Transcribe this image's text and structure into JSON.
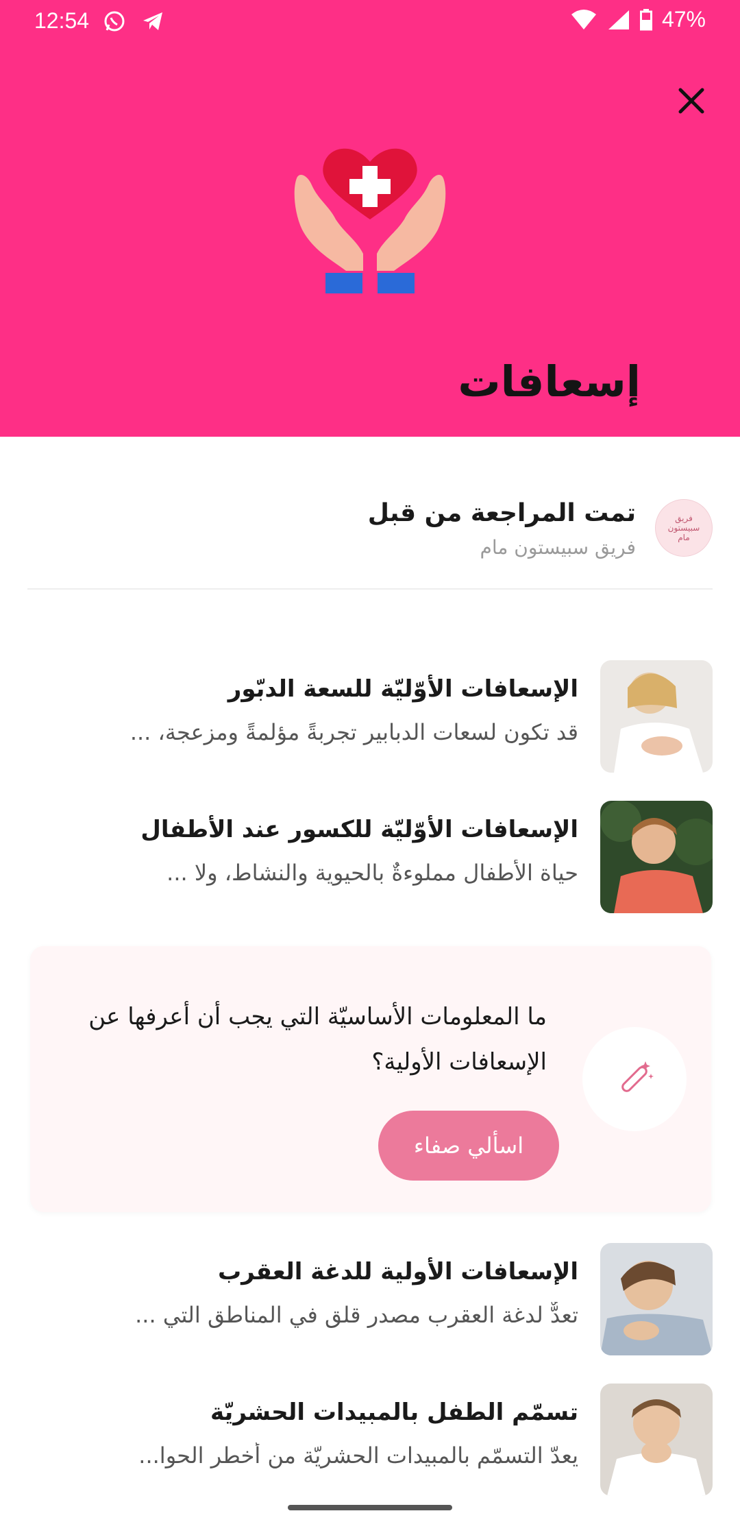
{
  "status_bar": {
    "time": "12:54",
    "battery": "47%",
    "icons": [
      "whatsapp-icon",
      "telegram-icon",
      "wifi-icon",
      "signal-icon",
      "battery-icon"
    ]
  },
  "header": {
    "title": "إسعافات",
    "background_color": "#fe2f86",
    "close_icon": "close-icon",
    "hero_icon": "hands-heart-medical-icon"
  },
  "reviewed": {
    "title": "تمت المراجعة من قبل",
    "reviewer": "فريق سبيستون مام",
    "avatar_text": "فريق سبيستون مام"
  },
  "articles": [
    {
      "title": "الإسعافات الأوّليّة للسعة الدبّور",
      "excerpt": "قد تكون لسعات الدبابير تجربةً مؤلمةً ومزعجة، ..."
    },
    {
      "title": "الإسعافات الأوّليّة للكسور عند الأطفال",
      "excerpt": "حياة الأطفال مملوءةٌ بالحيوية والنشاط، ولا ..."
    },
    {
      "title": "الإسعافات الأولية للدغة العقرب",
      "excerpt": "تعدٌّ لدغة العقرب مصدر قلق في المناطق التي ..."
    },
    {
      "title": "تسمّم الطفل بالمبيدات الحشريّة",
      "excerpt": "يعدّ التسمّم بالمبيدات الحشريّة من أخطر الحوا..."
    }
  ],
  "ask_card": {
    "question": "ما المعلومات الأساسيّة التي يجب أن أعرفها عن الإسعافات الأولية؟",
    "button_label": "اسألي صفاء",
    "icon": "magic-wand-icon",
    "accent_color": "#ec7a9b"
  }
}
